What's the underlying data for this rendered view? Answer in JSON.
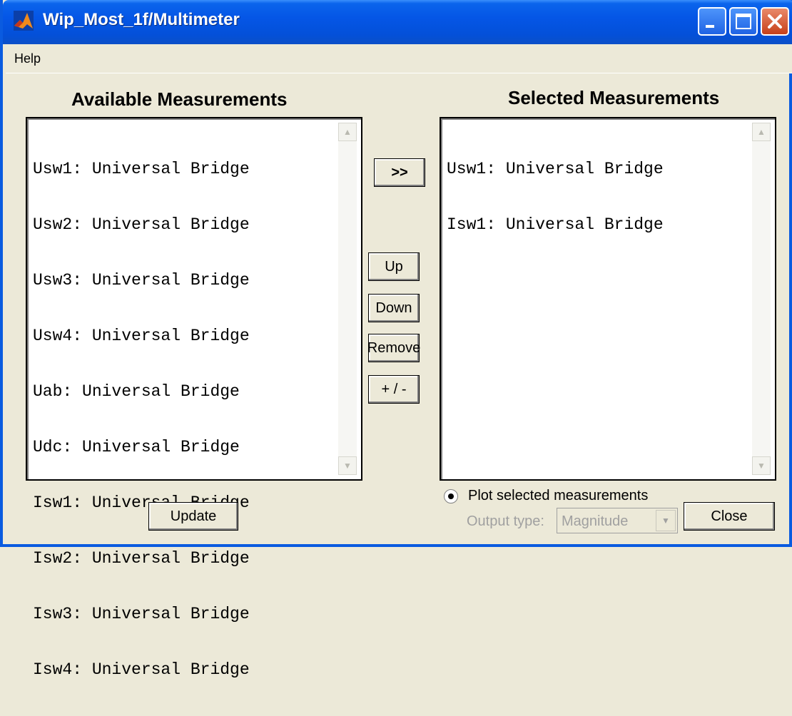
{
  "window": {
    "title": "Wip_Most_1f/Multimeter",
    "colors": {
      "titlebar": "#0556e6",
      "face": "#ece9d8",
      "disabled_text": "#a0a0a0"
    }
  },
  "menu": {
    "help": "Help"
  },
  "available": {
    "heading": "Available Measurements",
    "items": [
      "Usw1: Universal Bridge",
      "Usw2: Universal Bridge",
      "Usw3: Universal Bridge",
      "Usw4: Universal Bridge",
      "Uab: Universal Bridge",
      "Udc: Universal Bridge",
      "Isw1: Universal Bridge",
      "Isw2: Universal Bridge",
      "Isw3: Universal Bridge",
      "Isw4: Universal Bridge"
    ]
  },
  "selected": {
    "heading": "Selected Measurements",
    "items": [
      "Usw1: Universal Bridge",
      "Isw1: Universal Bridge"
    ]
  },
  "buttons": {
    "add": ">>",
    "up": "Up",
    "down": "Down",
    "remove": "Remove",
    "sign": "+ / -",
    "update": "Update",
    "close": "Close"
  },
  "plot": {
    "label": "Plot selected measurements",
    "checked": true,
    "output_type_label": "Output type:",
    "output_type_value": "Magnitude"
  },
  "icons": [
    "matlab-icon",
    "minimize-icon",
    "maximize-icon",
    "close-icon",
    "scroll-up-arrow-icon",
    "scroll-down-arrow-icon",
    "dropdown-arrow-icon"
  ]
}
